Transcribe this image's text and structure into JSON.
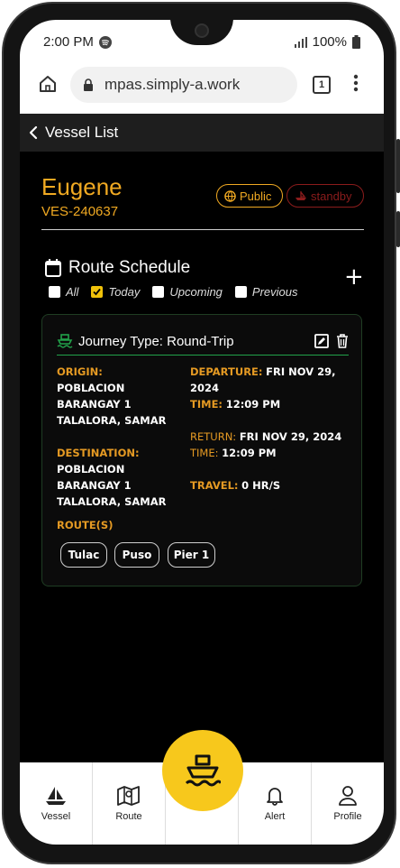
{
  "status_bar": {
    "time": "2:00 PM",
    "battery": "100%"
  },
  "browser": {
    "url": "mpas.simply-a.work",
    "tab_count": "1"
  },
  "nav": {
    "back_label": "Vessel List"
  },
  "vessel": {
    "name": "Eugene",
    "id": "VES-240637",
    "public_label": "Public",
    "standby_label": "standby"
  },
  "schedule": {
    "title": "Route Schedule",
    "filters": [
      {
        "label": "All",
        "checked": false
      },
      {
        "label": "Today",
        "checked": true
      },
      {
        "label": "Upcoming",
        "checked": false
      },
      {
        "label": "Previous",
        "checked": false
      }
    ]
  },
  "card": {
    "journey_type": "Journey Type: Round-Trip",
    "origin_label": "ORIGIN:",
    "origin_lines": [
      "POBLACION",
      "BARANGAY 1",
      "TALALORA, SAMAR"
    ],
    "destination_label": "DESTINATION:",
    "destination_lines": [
      "POBLACION",
      "BARANGAY 1",
      "TALALORA, SAMAR"
    ],
    "departure_label": "DEPARTURE:",
    "departure_value_1": "FRI NOV 29,",
    "departure_value_2": "2024",
    "departure_time_label": "TIME:",
    "departure_time": "12:09 PM",
    "return_label": "RETURN:",
    "return_value": "FRI NOV 29, 2024",
    "return_time_label": "TIME:",
    "return_time": "12:09 PM",
    "travel_label": "TRAVEL:",
    "travel_value": "0 HR/S",
    "routes_label": "ROUTE(S)",
    "routes": [
      "Tulac",
      "Puso",
      "Pier 1"
    ]
  },
  "bottom_nav": {
    "vessel": "Vessel",
    "route": "Route",
    "alert": "Alert",
    "profile": "Profile"
  },
  "colors": {
    "accent": "#f0a922",
    "fab": "#f7c81c",
    "green": "#22a24a",
    "standby": "#8b1c1c"
  }
}
